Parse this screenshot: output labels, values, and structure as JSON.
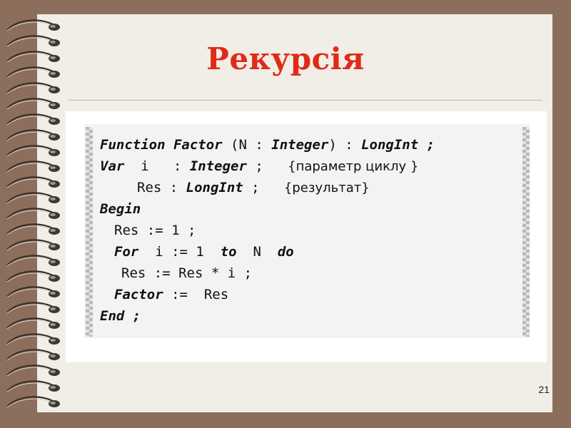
{
  "slide": {
    "title": "Рекурсія",
    "page_number": "21",
    "colors": {
      "background": "#8b6f5c",
      "slide": "#f0eee6",
      "title": "#e02a18",
      "code_panel": "#ffffff",
      "code_box": "#f3f3f3"
    }
  },
  "code": {
    "l1": {
      "kw1": "Function",
      "name": "Factor",
      "open": " (N : ",
      "type": "Integer",
      "close": ") : ",
      "ret": "LongInt",
      "end": " ;"
    },
    "l2": {
      "kw": "Var",
      "rest": "  i   : ",
      "type": "Integer",
      "semi": " ;   ",
      "comment": "{параметр циклу }"
    },
    "l3": {
      "rest": "Res : ",
      "type": "LongInt",
      "semi": " ;   ",
      "comment": "{результат}"
    },
    "l4": {
      "kw": "Begin"
    },
    "l5": {
      "text": "Res := 1 ;"
    },
    "l6": {
      "kw_for": "For",
      "mid": "  i := 1  ",
      "kw_to": "to",
      "mid2": "  N  ",
      "kw_do": "do"
    },
    "l7": {
      "text": "Res := Res * i ;"
    },
    "l8": {
      "name": "Factor",
      "rest": " :=  Res"
    },
    "l9": {
      "kw": "End",
      "semi": " ;"
    }
  }
}
